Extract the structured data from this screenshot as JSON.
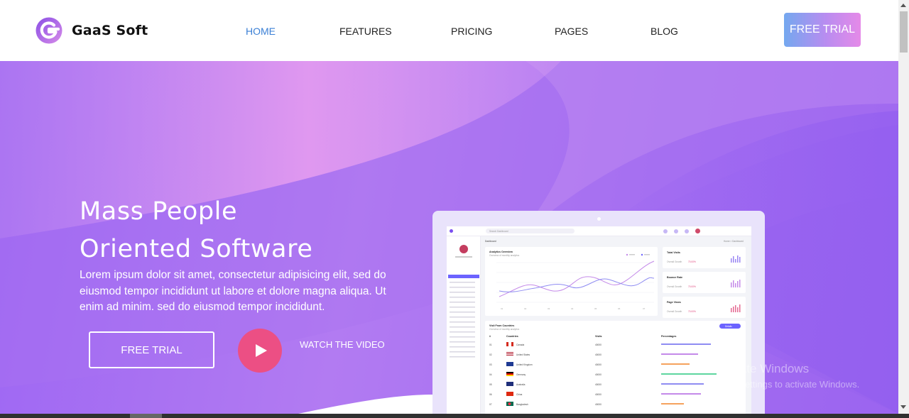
{
  "brand": {
    "name": "GaaS Soft",
    "logo_icon": "gaas-logo-icon",
    "accent": "#7b4ff0"
  },
  "nav": {
    "items": [
      {
        "label": "HOME",
        "active": true
      },
      {
        "label": "FEATURES",
        "active": false
      },
      {
        "label": "PRICING",
        "active": false
      },
      {
        "label": "PAGES",
        "active": false
      },
      {
        "label": "BLOG",
        "active": false
      }
    ],
    "cta": "FREE TRIAL"
  },
  "hero": {
    "title_line1": "Mass People",
    "title_line2": "Oriented Software",
    "description": "Lorem ipsum dolor sit amet, consectetur adipisicing elit, sed do eiusmod tempor incididunt ut labore et dolore magna aliqua. Ut enim ad minim. sed do eiusmod tempor incididunt.",
    "primary_button": "FREE TRIAL",
    "play_icon": "play-icon",
    "video_link": "WATCH THE VIDEO",
    "colors": {
      "gradient_start": "#9d66f3",
      "gradient_end": "#b27bf2",
      "play": "#ec4f84"
    }
  },
  "dashboard": {
    "search_placeholder": "Search Dashboard",
    "page_title": "Dashboard",
    "breadcrumb": "Home > Dashboard",
    "analytics": {
      "title": "Analytics Overview",
      "subtitle": "Overview of monthly analytics"
    },
    "stats": [
      {
        "title": "Total Visits",
        "label": "Overall Growth",
        "value": "70.00%"
      },
      {
        "title": "Bounce Rate",
        "label": "Overall Growth",
        "value": "70.00%"
      },
      {
        "title": "Page Views",
        "label": "Overall Growth",
        "value": "70.00%"
      }
    ],
    "countries": {
      "title": "Visit From Countries",
      "subtitle": "Overview of monthly analytics",
      "button": "Details",
      "columns": [
        "#",
        "Countries",
        "Visits",
        "Percentages"
      ],
      "rows": [
        {
          "num": "01",
          "name": "Canada",
          "visits": "40000"
        },
        {
          "num": "02",
          "name": "United States",
          "visits": "40000"
        },
        {
          "num": "03",
          "name": "United Kingdom",
          "visits": "40000"
        },
        {
          "num": "04",
          "name": "Germany",
          "visits": "40000"
        },
        {
          "num": "05",
          "name": "Australia",
          "visits": "40000"
        },
        {
          "num": "06",
          "name": "China",
          "visits": "40000"
        },
        {
          "num": "07",
          "name": "Bangladesh",
          "visits": "40000"
        }
      ]
    }
  },
  "watermark": {
    "line1": "Activate Windows",
    "line2": "Go to Settings to activate Windows."
  }
}
